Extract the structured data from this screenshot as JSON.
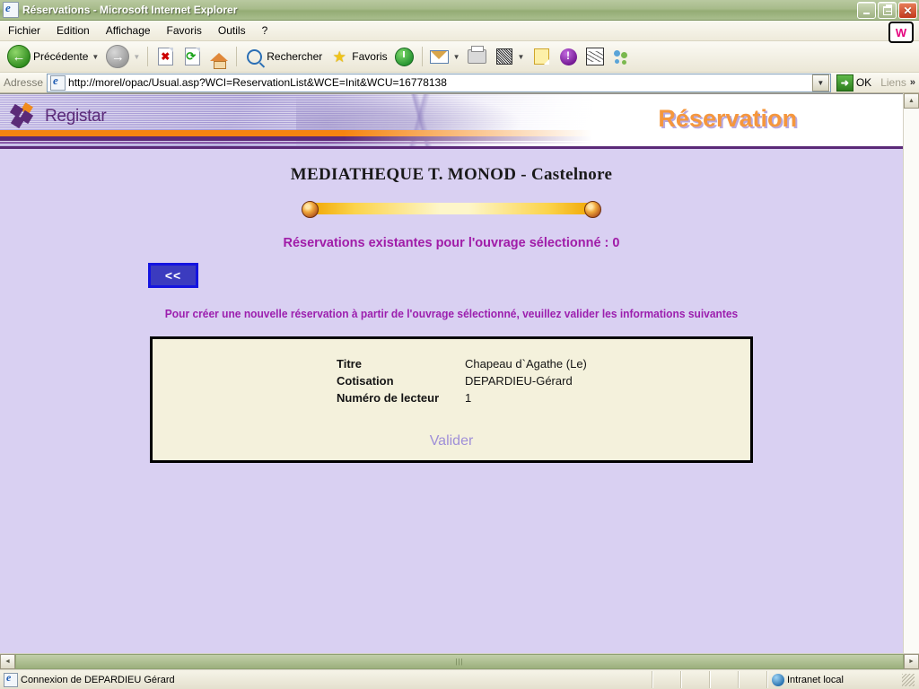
{
  "window": {
    "title": "Réservations - Microsoft Internet Explorer",
    "app_icon": "ie-page-icon",
    "controls": {
      "minimize": "Réduire",
      "restore": "Restaurer",
      "close": "Fermer"
    }
  },
  "menubar": {
    "items": [
      {
        "label": "Fichier",
        "name": "menu-fichier"
      },
      {
        "label": "Edition",
        "name": "menu-edition"
      },
      {
        "label": "Affichage",
        "name": "menu-affichage"
      },
      {
        "label": "Favoris",
        "name": "menu-favoris"
      },
      {
        "label": "Outils",
        "name": "menu-outils"
      },
      {
        "label": "?",
        "name": "menu-aide"
      }
    ],
    "brand_letter": "W"
  },
  "toolbar": {
    "back_label": "Précédente",
    "forward_label": "",
    "search_label": "Rechercher",
    "favorites_label": "Favoris",
    "icons": [
      "back-icon",
      "forward-icon",
      "stop-icon",
      "refresh-icon",
      "home-icon",
      "search-icon",
      "favorites-star-icon",
      "history-icon",
      "mail-icon",
      "print-icon",
      "edit-icon",
      "notes-icon",
      "messenger-icon",
      "discuss-icon",
      "people-icon"
    ]
  },
  "address": {
    "label": "Adresse",
    "url": "http://morel/opac/Usual.asp?WCI=ReservationList&WCE=Init&WCU=16778138",
    "placeholder": "",
    "go_label": "OK",
    "links_label": "Liens"
  },
  "banner": {
    "logo_text": "Registar",
    "page_title": "Réservation",
    "colors": {
      "orange": "#f58410",
      "purple": "#5b2a78",
      "title_orange": "#f5973d"
    }
  },
  "content": {
    "library_heading": "MEDIATHEQUE T. MONOD - Castelnore",
    "existing_reservations": "Réservations existantes pour l'ouvrage sélectionné : 0",
    "back_button_label": "<<",
    "instructions": "Pour créer une nouvelle réservation à partir de l'ouvrage sélectionné, veuillez valider les informations suivantes",
    "form": {
      "fields": [
        {
          "label": "Titre",
          "value": "Chapeau d`Agathe (Le)"
        },
        {
          "label": "Cotisation",
          "value": "DEPARDIEU-Gérard"
        },
        {
          "label": "Numéro de lecteur",
          "value": "1"
        }
      ],
      "submit_label": "Valider"
    },
    "colors": {
      "page_background": "#d9d0f2",
      "form_background": "#f4f1dc",
      "heading_magenta": "#a01ca8",
      "submit_link": "#9f8fd8"
    }
  },
  "statusbar": {
    "message": "Connexion de DEPARDIEU Gérard",
    "zone": "Intranet local"
  }
}
